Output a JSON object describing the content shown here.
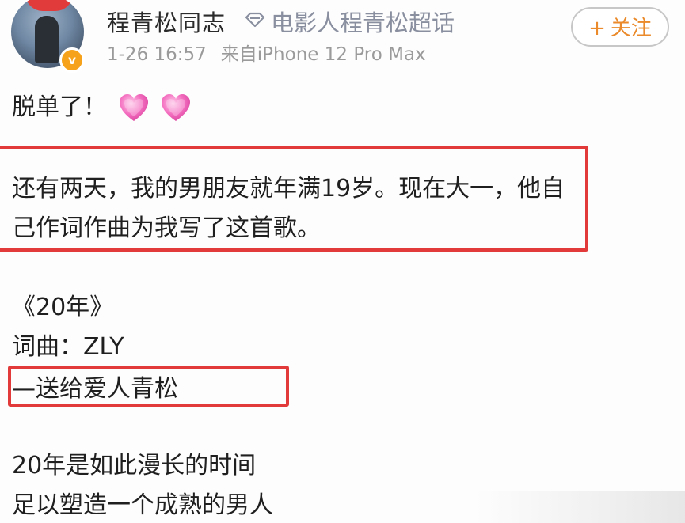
{
  "header": {
    "user_name": "程青松同志",
    "super_topic": "电影人程青松超话",
    "timestamp": "1-26 16:57",
    "source": "来自iPhone 12 Pro Max",
    "follow_plus": "+",
    "follow_label": "关注",
    "verified_icon": "verified-badge-icon",
    "super_topic_icon": "diamond-link-icon"
  },
  "post": {
    "line1": "脱单了！",
    "emoji": "pink-heart-icon",
    "line2": "还有两天，我的男朋友就年满19岁。现在大一，他自",
    "line3": "己作词作曲为我写了这首歌。",
    "song_title": "《20年》",
    "credits": "词曲：ZLY",
    "dedication": "—送给爱人青松",
    "lyric1": "20年是如此漫长的时间",
    "lyric2": "足以塑造一个成熟的男人"
  },
  "colors": {
    "highlight": "#e23a3a",
    "follow_accent": "#ea8a2a",
    "meta_gray": "#9a9a9a",
    "badge_orange": "#f6a21a"
  }
}
